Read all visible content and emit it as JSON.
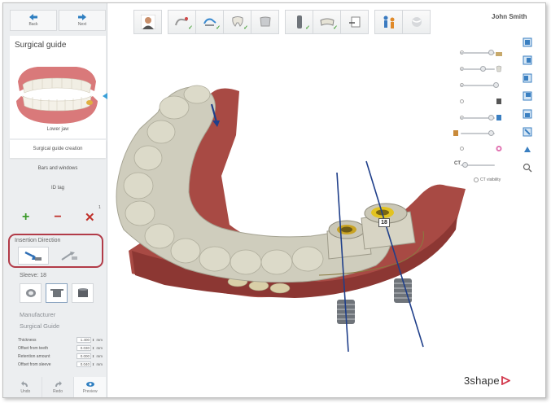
{
  "nav": {
    "back_label": "Back",
    "next_label": "Next"
  },
  "panel": {
    "title": "Surgical guide",
    "jaw_label": "Lower jaw",
    "steps": [
      "Surgical guide creation",
      "Bars and windows",
      "ID tag"
    ],
    "action_count": "1"
  },
  "insertion": {
    "label": "Insertion Direction"
  },
  "sleeve": {
    "label": "Sleeve: 18"
  },
  "manufacturer": {
    "label": "Manufacturer",
    "value": "Surgical Guide"
  },
  "params": [
    {
      "name": "Thickness",
      "value": "1.400",
      "unit": "mm"
    },
    {
      "name": "Offset from teeth",
      "value": "0.030",
      "unit": "mm"
    },
    {
      "name": "Retention amount",
      "value": "0.000",
      "unit": "mm"
    },
    {
      "name": "Offset from sleeve",
      "value": "0.040",
      "unit": "mm"
    }
  ],
  "bottom": {
    "undo_label": "Undo",
    "redo_label": "Redo",
    "preview_label": "Preview"
  },
  "user": {
    "name": "John Smith"
  },
  "visibility": {
    "ct_label": "CT",
    "ct_visibility_label": "CT visibility"
  },
  "scene": {
    "implant_tag": "18"
  },
  "brand": {
    "logo_text": "3shape"
  },
  "colors": {
    "accent": "#3aa0d8",
    "highlight": "#b23b48",
    "add": "#3b9a2a",
    "remove": "#c0302a"
  }
}
